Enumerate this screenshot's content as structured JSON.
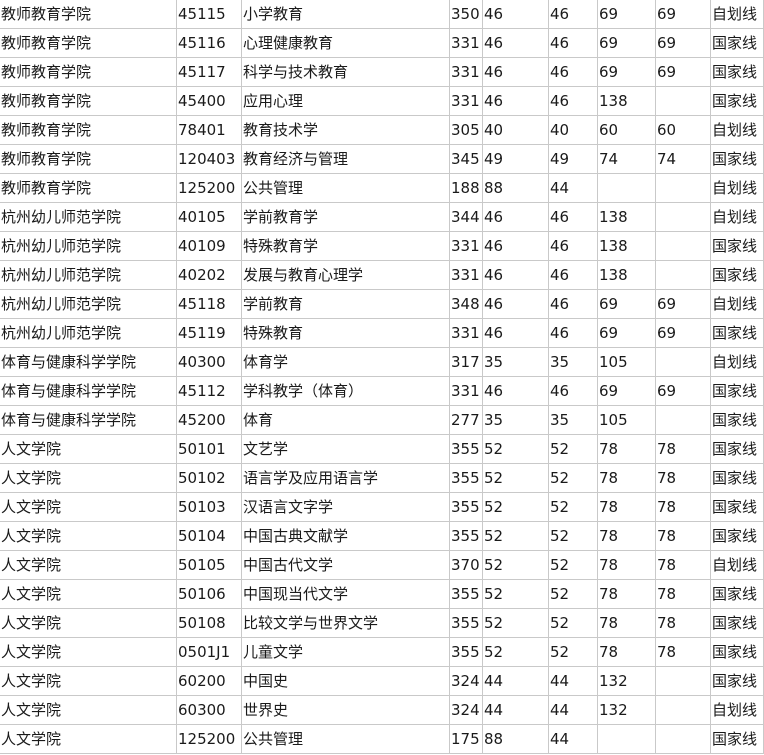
{
  "table": {
    "rows": [
      [
        "教师教育学院",
        "45115",
        "小学教育",
        "350",
        "46",
        "46",
        "69",
        "69",
        "自划线"
      ],
      [
        "教师教育学院",
        "45116",
        "心理健康教育",
        "331",
        "46",
        "46",
        "69",
        "69",
        "国家线"
      ],
      [
        "教师教育学院",
        "45117",
        "科学与技术教育",
        "331",
        "46",
        "46",
        "69",
        "69",
        "国家线"
      ],
      [
        "教师教育学院",
        "45400",
        "应用心理",
        "331",
        "46",
        "46",
        "138",
        "",
        "国家线"
      ],
      [
        "教师教育学院",
        "78401",
        "教育技术学",
        "305",
        "40",
        "40",
        "60",
        "60",
        "自划线"
      ],
      [
        "教师教育学院",
        "120403",
        "教育经济与管理",
        "345",
        "49",
        "49",
        "74",
        "74",
        "国家线"
      ],
      [
        "教师教育学院",
        "125200",
        "公共管理",
        "188",
        "88",
        "44",
        "",
        "",
        "自划线"
      ],
      [
        "杭州幼儿师范学院",
        "40105",
        "学前教育学",
        "344",
        "46",
        "46",
        "138",
        "",
        "自划线"
      ],
      [
        "杭州幼儿师范学院",
        "40109",
        "特殊教育学",
        "331",
        "46",
        "46",
        "138",
        "",
        "国家线"
      ],
      [
        "杭州幼儿师范学院",
        "40202",
        "发展与教育心理学",
        "331",
        "46",
        "46",
        "138",
        "",
        "国家线"
      ],
      [
        "杭州幼儿师范学院",
        "45118",
        "学前教育",
        "348",
        "46",
        "46",
        "69",
        "69",
        "自划线"
      ],
      [
        "杭州幼儿师范学院",
        "45119",
        "特殊教育",
        "331",
        "46",
        "46",
        "69",
        "69",
        "国家线"
      ],
      [
        "体育与健康科学学院",
        "40300",
        "体育学",
        "317",
        "35",
        "35",
        "105",
        "",
        "自划线"
      ],
      [
        "体育与健康科学学院",
        "45112",
        "学科教学（体育）",
        "331",
        "46",
        "46",
        "69",
        "69",
        "国家线"
      ],
      [
        "体育与健康科学学院",
        "45200",
        "体育",
        "277",
        "35",
        "35",
        "105",
        "",
        "国家线"
      ],
      [
        "人文学院",
        "50101",
        "文艺学",
        "355",
        "52",
        "52",
        "78",
        "78",
        "国家线"
      ],
      [
        "人文学院",
        "50102",
        "语言学及应用语言学",
        "355",
        "52",
        "52",
        "78",
        "78",
        "国家线"
      ],
      [
        "人文学院",
        "50103",
        "汉语言文字学",
        "355",
        "52",
        "52",
        "78",
        "78",
        "国家线"
      ],
      [
        "人文学院",
        "50104",
        "中国古典文献学",
        "355",
        "52",
        "52",
        "78",
        "78",
        "国家线"
      ],
      [
        "人文学院",
        "50105",
        "中国古代文学",
        "370",
        "52",
        "52",
        "78",
        "78",
        "自划线"
      ],
      [
        "人文学院",
        "50106",
        "中国现当代文学",
        "355",
        "52",
        "52",
        "78",
        "78",
        "国家线"
      ],
      [
        "人文学院",
        "50108",
        "比较文学与世界文学",
        "355",
        "52",
        "52",
        "78",
        "78",
        "国家线"
      ],
      [
        "人文学院",
        "0501J1",
        "儿童文学",
        "355",
        "52",
        "52",
        "78",
        "78",
        "国家线"
      ],
      [
        "人文学院",
        "60200",
        "中国史",
        "324",
        "44",
        "44",
        "132",
        "",
        "国家线"
      ],
      [
        "人文学院",
        "60300",
        "世界史",
        "324",
        "44",
        "44",
        "132",
        "",
        "自划线"
      ],
      [
        "人文学院",
        "125200",
        "公共管理",
        "175",
        "88",
        "44",
        "",
        "",
        "国家线"
      ]
    ]
  }
}
